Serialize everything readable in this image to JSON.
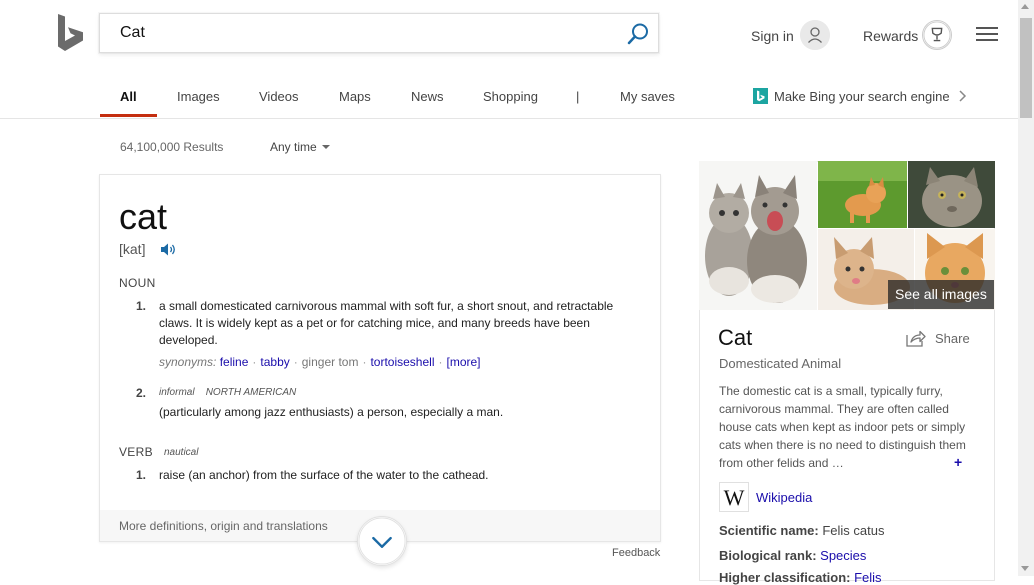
{
  "search": {
    "query": "Cat"
  },
  "header": {
    "sign_in": "Sign in",
    "rewards": "Rewards"
  },
  "tabs": [
    {
      "label": "All"
    },
    {
      "label": "Images"
    },
    {
      "label": "Videos"
    },
    {
      "label": "Maps"
    },
    {
      "label": "News"
    },
    {
      "label": "Shopping"
    },
    {
      "label": "|"
    },
    {
      "label": "My saves"
    }
  ],
  "promo": {
    "label": "Make Bing your search engine"
  },
  "results": {
    "count": "64,100,000 Results",
    "time_filter": "Any time"
  },
  "dictionary": {
    "word": "cat",
    "pronunciation": "[kat]",
    "noun_label": "NOUN",
    "defs": [
      {
        "num": "1.",
        "text": "a small domesticated carnivorous mammal with soft fur, a short snout, and retractable claws. It is widely kept as a pet or for catching mice, and many breeds have been developed."
      },
      {
        "num": "2.",
        "tag1": "informal",
        "tag2": "NORTH AMERICAN",
        "text": "(particularly among jazz enthusiasts) a person, especially a man."
      }
    ],
    "synonyms": {
      "label": "synonyms:",
      "items": [
        "feline",
        "tabby",
        "ginger tom",
        "tortoiseshell"
      ],
      "more": "[more]"
    },
    "verb_label": "VERB",
    "verb_tag": "nautical",
    "verb_defs": [
      {
        "num": "1.",
        "text": "raise (an anchor) from the surface of the water to the cathead."
      }
    ],
    "more_link": "More definitions, origin and translations",
    "feedback": "Feedback"
  },
  "knowledge": {
    "see_all": "See all images",
    "title": "Cat",
    "subtitle": "Domesticated Animal",
    "share": "Share",
    "description": "The domestic cat is a small, typically furry, carnivorous mammal. They are often called house cats when kept as indoor pets or simply cats when there is no need to distinguish them from other felids and …",
    "plus": "+",
    "wiki_letter": "W",
    "wiki_link": "Wikipedia",
    "facts": [
      {
        "label": "Scientific name:",
        "value": "Felis catus"
      },
      {
        "label": "Biological rank:",
        "value": "Species"
      },
      {
        "label": "Higher classification:",
        "value": "Felis"
      }
    ]
  },
  "colors": {
    "accent": "#c42e10",
    "link": "#1a0dab",
    "bing_teal": "#1ca5a1",
    "search_icon": "#1b6aa5"
  }
}
